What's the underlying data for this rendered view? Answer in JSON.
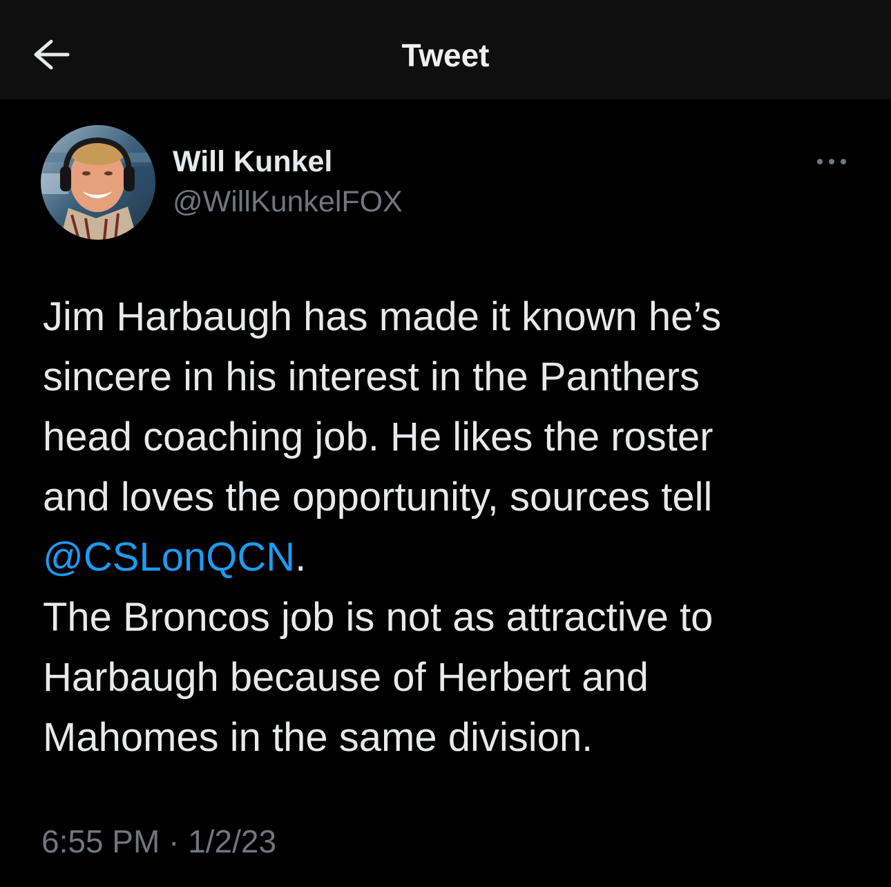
{
  "header": {
    "title": "Tweet",
    "back_icon": "arrow-left-icon"
  },
  "author": {
    "name": "Will Kunkel",
    "handle": "@WillKunkelFOX"
  },
  "more_icon": "more-horizontal-icon",
  "tweet": {
    "line1": "Jim Harbaugh has made it known he’s",
    "line2": "sincere in his interest in the Panthers",
    "line3": "head coaching job. He likes the roster",
    "line4": "and loves the opportunity, sources tell",
    "mention": "@CSLonQCN",
    "mention_suffix": ".",
    "line6": "The Broncos job is not as attractive to",
    "line7": "Harbaugh because of Herbert and",
    "line8": "Mahomes in the same division."
  },
  "timestamp": "6:55 PM · 1/2/23",
  "colors": {
    "background": "#000000",
    "topbar": "#0f0f0f",
    "text": "#e7e9ea",
    "secondary": "#71767b",
    "link": "#1d9bf0"
  }
}
